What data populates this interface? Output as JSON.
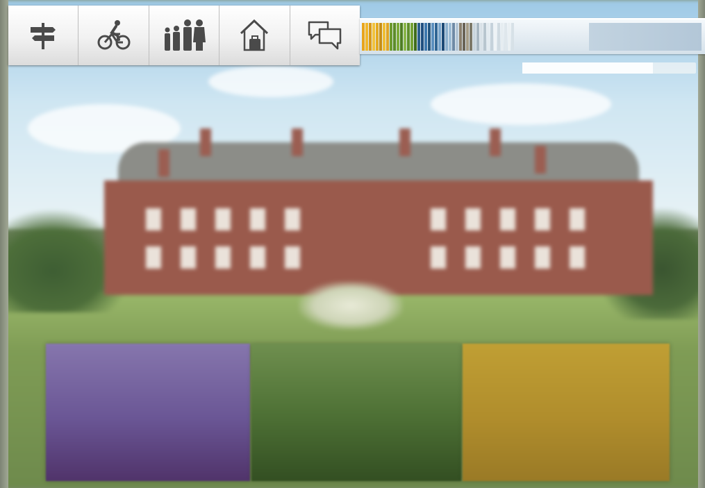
{
  "toolbar": {
    "buttons": [
      {
        "id": "signpost",
        "icon": "signpost-icon"
      },
      {
        "id": "cycling",
        "icon": "bicycle-icon"
      },
      {
        "id": "family",
        "icon": "family-icon"
      },
      {
        "id": "accommodation",
        "icon": "house-suitcase-icon"
      },
      {
        "id": "chat",
        "icon": "speech-bubbles-icon"
      }
    ]
  },
  "color_stripe": {
    "colors": [
      "#e8a51c",
      "#f0b72a",
      "#d99a1a",
      "#f2c23c",
      "#e3aa22",
      "#c78f16",
      "#f0be32",
      "#e0a524",
      "#6c9a2e",
      "#5d8c28",
      "#7eab3a",
      "#4f7e22",
      "#8ab64a",
      "#5f8f2a",
      "#74a234",
      "#3f6c1c",
      "#2b5e8c",
      "#1f4f80",
      "#3d78ad",
      "#24567f",
      "#5b8fbe",
      "#2f6594",
      "#7aa6cc",
      "#1d4a76",
      "#8db1cf",
      "#9dbdd6",
      "#6e8aa6",
      "#b3c6d6",
      "#8a7f6d",
      "#6a6356",
      "#a69c86",
      "#7c7868",
      "#c9d5dd",
      "#a8b7c2",
      "#d9e2e8",
      "#b8c6cf",
      "#e3ebf0",
      "#c5d2db",
      "#eef3f6",
      "#d0dbe2",
      "#e6edf1",
      "#dfe7ec",
      "#eaf0f3",
      "#d7e1e7"
    ],
    "accent": "#b3c7d8"
  },
  "progress": {
    "value": 0.75
  },
  "tiles": [
    {
      "id": "purple",
      "color": "#6a5695"
    },
    {
      "id": "green",
      "color": "#4f7236"
    },
    {
      "id": "yellow",
      "color": "#b08d2c"
    }
  ]
}
